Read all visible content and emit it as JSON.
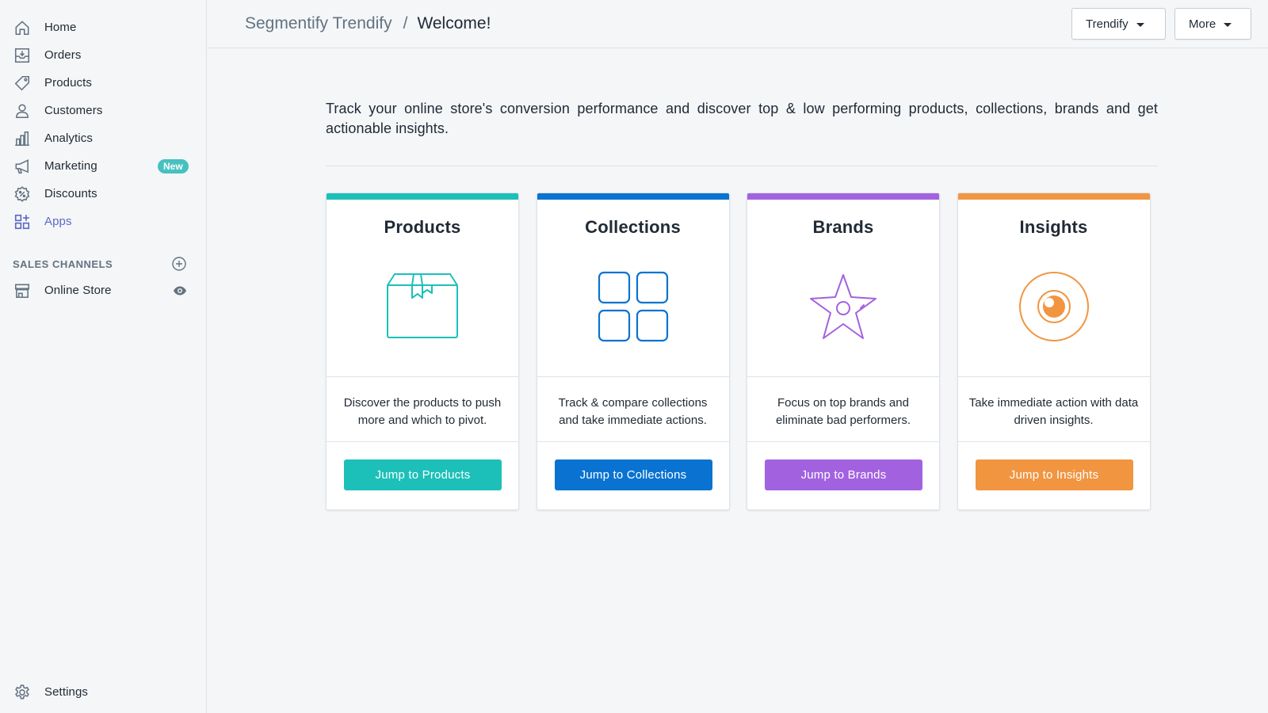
{
  "colors": {
    "products": "#1cc0b9",
    "collections": "#0a73d1",
    "brands": "#a262e0",
    "insights": "#f19541",
    "new_badge": "#47c1bf",
    "active_nav": "#5c6ac4"
  },
  "sidebar": {
    "items": [
      {
        "label": "Home",
        "icon": "home-icon"
      },
      {
        "label": "Orders",
        "icon": "orders-icon"
      },
      {
        "label": "Products",
        "icon": "tag-icon"
      },
      {
        "label": "Customers",
        "icon": "customer-icon"
      },
      {
        "label": "Analytics",
        "icon": "analytics-icon"
      },
      {
        "label": "Marketing",
        "icon": "megaphone-icon",
        "badge": "New"
      },
      {
        "label": "Discounts",
        "icon": "discount-icon"
      },
      {
        "label": "Apps",
        "icon": "apps-icon",
        "active": true
      }
    ],
    "sales_channels": {
      "heading": "SALES CHANNELS",
      "items": [
        {
          "label": "Online Store",
          "icon": "store-icon"
        }
      ]
    },
    "settings": {
      "label": "Settings",
      "icon": "gear-icon"
    }
  },
  "header": {
    "breadcrumb_parent": "Segmentify Trendify",
    "separator": "/",
    "title": "Welcome!",
    "actions": [
      {
        "label": "Trendify"
      },
      {
        "label": "More"
      }
    ]
  },
  "main": {
    "intro": "Track your online store's conversion performance and discover top & low performing products, collections, brands and get actionable insights.",
    "cards": [
      {
        "title": "Products",
        "description": "Discover the products to push more and which to pivot.",
        "button": "Jump to Products",
        "icon": "box-icon"
      },
      {
        "title": "Collections",
        "description": "Track & compare collections and take immediate actions.",
        "button": "Jump to Collections",
        "icon": "grid-icon"
      },
      {
        "title": "Brands",
        "description": "Focus on top brands and eliminate bad performers.",
        "button": "Jump to Brands",
        "icon": "star-icon"
      },
      {
        "title": "Insights",
        "description": "Take immediate action with data driven insights.",
        "button": "Jump to Insights",
        "icon": "eye-icon"
      }
    ]
  }
}
